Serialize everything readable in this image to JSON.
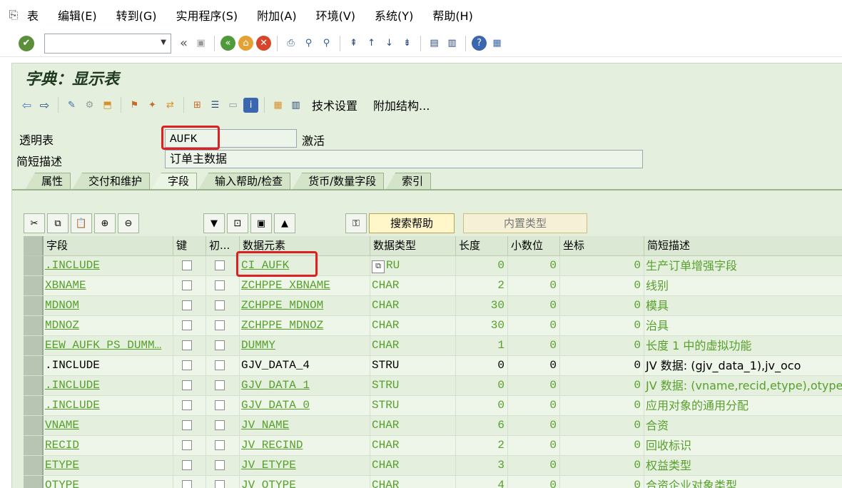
{
  "menu": {
    "items": [
      "表",
      "编辑(E)",
      "转到(G)",
      "实用程序(S)",
      "附加(A)",
      "环境(V)",
      "系统(Y)",
      "帮助(H)"
    ]
  },
  "system_toolbar": {
    "command_value": "",
    "back_glyph": "«"
  },
  "screen": {
    "title": "字典：显示表",
    "app_toolbar": {
      "tech_settings": "技术设置",
      "append_structure": "附加结构..."
    },
    "header": {
      "table_label": "透明表",
      "table_value": "AUFK",
      "status": "激活",
      "desc_label": "简短描述",
      "desc_value": "订单主数据"
    },
    "tabs": [
      "属性",
      "交付和维护",
      "字段",
      "输入帮助/检查",
      "货币/数量字段",
      "索引"
    ],
    "active_tab": "字段",
    "search_help_button": "搜索帮助",
    "builtin_type_button": "内置类型",
    "columns": [
      "字段",
      "键",
      "初...",
      "数据元素",
      "数据类型",
      "长度",
      "小数位",
      "坐标",
      "简短描述"
    ],
    "rows": [
      {
        "field": ".INCLUDE",
        "element": "CI_AUFK",
        "type": "RU",
        "length": "0",
        "decimals": "0",
        "coord": "0",
        "desc": "生产订单增强字段",
        "style": "green"
      },
      {
        "field": "XBNAME",
        "element": "ZCHPPE_XBNAME",
        "type": "CHAR",
        "length": "2",
        "decimals": "0",
        "coord": "0",
        "desc": "线别",
        "style": "green"
      },
      {
        "field": "MDNOM",
        "element": "ZCHPPE_MDNOM",
        "type": "CHAR",
        "length": "30",
        "decimals": "0",
        "coord": "0",
        "desc": "模具",
        "style": "green"
      },
      {
        "field": "MDNOZ",
        "element": "ZCHPPE_MDNOZ",
        "type": "CHAR",
        "length": "30",
        "decimals": "0",
        "coord": "0",
        "desc": "治具",
        "style": "green"
      },
      {
        "field": "EEW_AUFK_PS_DUMM…",
        "element": "DUMMY",
        "type": "CHAR",
        "length": "1",
        "decimals": "0",
        "coord": "0",
        "desc": "长度 1 中的虚拟功能",
        "style": "green"
      },
      {
        "field": ".INCLUDE",
        "element": "GJV_DATA_4",
        "type": "STRU",
        "length": "0",
        "decimals": "0",
        "coord": "0",
        "desc": "JV 数据: (gjv_data_1),jv_oco",
        "style": "dark"
      },
      {
        "field": ".INCLUDE",
        "element": "GJV_DATA_1",
        "type": "STRU",
        "length": "0",
        "decimals": "0",
        "coord": "0",
        "desc": "JV 数据: (vname,recid,etype),otype,jv_",
        "style": "green"
      },
      {
        "field": ".INCLUDE",
        "element": "GJV_DATA_0",
        "type": "STRU",
        "length": "0",
        "decimals": "0",
        "coord": "0",
        "desc": "应用对象的通用分配",
        "style": "green"
      },
      {
        "field": "VNAME",
        "element": "JV_NAME",
        "type": "CHAR",
        "length": "6",
        "decimals": "0",
        "coord": "0",
        "desc": "合资",
        "style": "green"
      },
      {
        "field": "RECID",
        "element": "JV_RECIND",
        "type": "CHAR",
        "length": "2",
        "decimals": "0",
        "coord": "0",
        "desc": "回收标识",
        "style": "green"
      },
      {
        "field": "ETYPE",
        "element": "JV_ETYPE",
        "type": "CHAR",
        "length": "3",
        "decimals": "0",
        "coord": "0",
        "desc": "权益类型",
        "style": "green"
      },
      {
        "field": "OTYPE",
        "element": "JV_OTYPE",
        "type": "CHAR",
        "length": "4",
        "decimals": "0",
        "coord": "0",
        "desc": "合资企业对象类型",
        "style": "green"
      }
    ]
  },
  "colors": {
    "screen_bg": "#e4efdd",
    "link_green": "#57a02d",
    "highlight_red": "#e02020"
  }
}
